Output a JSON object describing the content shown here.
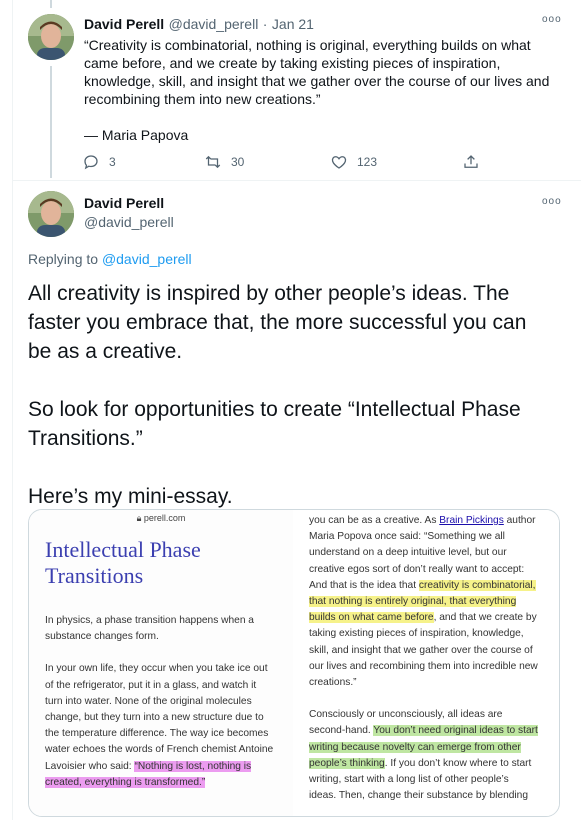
{
  "thread_tweet": {
    "author_name": "David Perell",
    "handle": "@david_perell",
    "separator": "·",
    "date": "Jan 21",
    "more": "ooo",
    "quote_lines": [
      "“Creativity is combinatorial, nothing is original, everything builds on what",
      "came before, and we create by taking existing pieces of inspiration,",
      "knowledge, skill, and insight that we gather over the course of our lives and",
      "recombining them into new creations.”"
    ],
    "attribution": "— Maria Papova",
    "replies": "3",
    "retweets": "30",
    "likes": "123"
  },
  "main_tweet": {
    "author_name": "David Perell",
    "handle": "@david_perell",
    "more": "ooo",
    "replying_prefix": "Replying to",
    "replying_handle": "@david_perell",
    "body_lines": [
      "All creativity is inspired by other people’s ideas. The",
      "faster you embrace that, the more successful you can",
      "be as a creative.",
      "So look for opportunities to create “Intellectual Phase",
      "Transitions.”",
      "Here’s my mini-essay."
    ]
  },
  "essay_image": {
    "url_bar": "perell.com",
    "title_line1": "Intellectual Phase",
    "title_line2": "Transitions",
    "left_p1": [
      "In physics, a phase transition happens when a",
      "substance changes form."
    ],
    "left_p2": [
      "In your own life, they occur when you take ice out",
      "of the refrigerator, put it in a glass, and watch it",
      "turn into water. None of the original molecules",
      "change, but they turn into a new structure due to",
      "the temperature difference. The way ice becomes",
      "water echoes the words of French chemist Antoine"
    ],
    "left_l9_plain": "Lavoisier who said: ",
    "left_l9_hl": "“Nothing is lost, nothing is",
    "left_l10_hl": "created, everything is transformed.”",
    "r1_plain": "you can be as a creative. As ",
    "r1_link": "Brain Pickings",
    "r1_end": " author",
    "r2": "Maria Popova once said: “Something we all",
    "r3": "understand on a deep intuitive level, but our",
    "r4": "creative egos sort of don’t really want to accept:",
    "r5_plain": "And that is the idea that ",
    "r5_hl": "creativity is combinatorial,",
    "r6_hl": "that nothing is entirely original, that everything",
    "r7_hl": "builds on what came before",
    "r7_end": ", and that we create by",
    "r8": "taking existing pieces of inspiration, knowledge,",
    "r9": "skill, and insight that we gather over the course of",
    "r10": "our lives and recombining them into incredible new",
    "r11": "creations.”",
    "r12": "Consciously or unconsciously, all ideas are",
    "r13_plain": "second-hand. ",
    "r13_hl": "You don’t need original ideas to start",
    "r14_hl": "writing because novelty can emerge from other",
    "r15_hl": "people’s thinking",
    "r15_end": ". If you don’t know where to start",
    "r16": "writing, start with a long list of other people’s",
    "r17": "ideas. Then, change their substance by blending"
  }
}
